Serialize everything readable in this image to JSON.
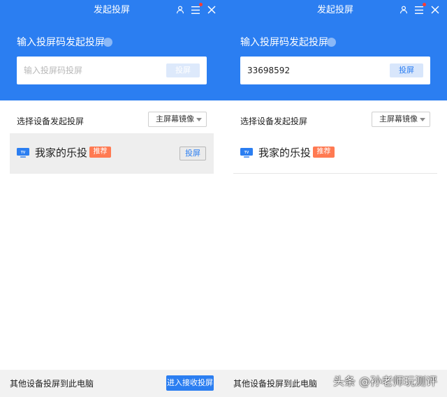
{
  "colors": {
    "accent": "#2b7ef1",
    "badge": "#ff7a52",
    "notification": "#ff3b30"
  },
  "left": {
    "window_title": "发起投屏",
    "hero_title": "输入投屏码发起投屏",
    "code_input": {
      "value": "",
      "placeholder": "输入投屏码投屏",
      "button_label": "投屏"
    },
    "section_label": "选择设备发起投屏",
    "mode_select": {
      "selected": "主屏幕镜像"
    },
    "device": {
      "icon": "tv-icon",
      "icon_text": "TV",
      "name": "我家的乐投",
      "badge": "推荐",
      "button_label": "投屏"
    },
    "footer": {
      "text": "其他设备投屏到此电脑",
      "button_label": "进入接收投屏"
    }
  },
  "right": {
    "window_title": "发起投屏",
    "hero_title": "输入投屏码发起投屏",
    "code_input": {
      "value": "33698592",
      "placeholder": "",
      "button_label": "投屏"
    },
    "section_label": "选择设备发起投屏",
    "mode_select": {
      "selected": "主屏幕镜像"
    },
    "device": {
      "icon": "tv-icon",
      "icon_text": "TV",
      "name": "我家的乐投",
      "badge": "推荐"
    },
    "footer": {
      "text": "其他设备投屏到此电脑"
    }
  },
  "watermark": "头条 @孙老师玩测评"
}
